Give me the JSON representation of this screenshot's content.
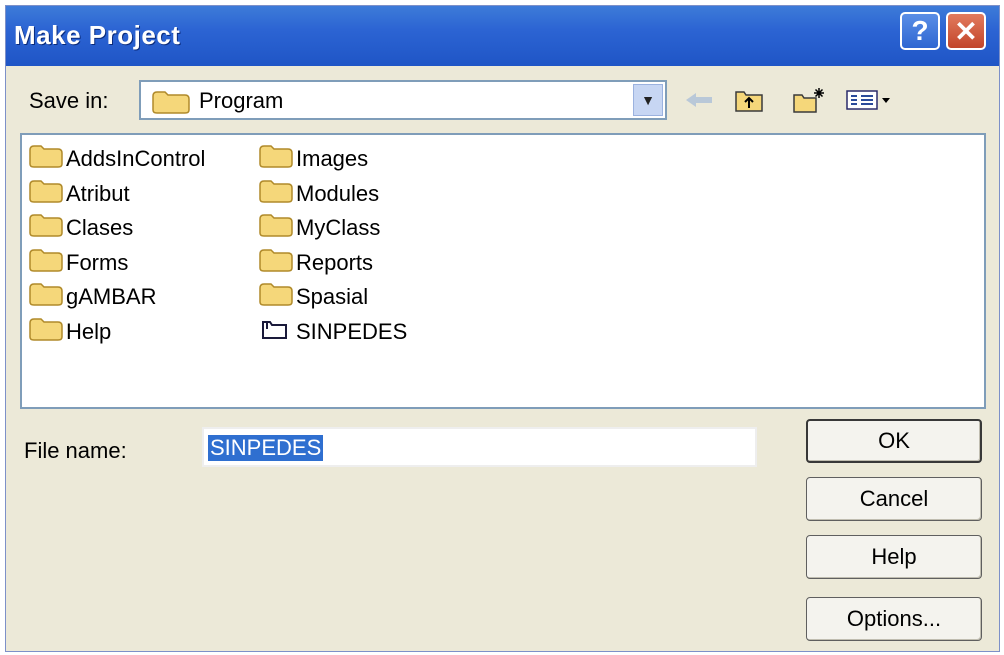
{
  "window": {
    "title": "Make Project",
    "help_symbol": "?",
    "close_symbol": "✕"
  },
  "toolbar": {
    "save_in_label": "Save in:",
    "location": "Program",
    "icons": [
      "folder-icon",
      "back-arrow-icon",
      "up-folder-icon",
      "new-folder-icon",
      "view-menu-icon"
    ]
  },
  "files": {
    "items": [
      {
        "name": "AddsInControl",
        "icon": "folder-icon"
      },
      {
        "name": "Atribut",
        "icon": "folder-icon"
      },
      {
        "name": "Clases",
        "icon": "folder-icon"
      },
      {
        "name": "Forms",
        "icon": "folder-icon"
      },
      {
        "name": "gAMBAR",
        "icon": "folder-icon"
      },
      {
        "name": "Help",
        "icon": "folder-icon"
      },
      {
        "name": "Images",
        "icon": "folder-icon"
      },
      {
        "name": "Modules",
        "icon": "folder-icon"
      },
      {
        "name": "MyClass",
        "icon": "folder-icon"
      },
      {
        "name": "Reports",
        "icon": "folder-icon"
      },
      {
        "name": "Spasial",
        "icon": "folder-icon"
      },
      {
        "name": "SINPEDES",
        "icon": "project-file-icon"
      }
    ]
  },
  "form": {
    "file_name_label": "File name:",
    "file_name_value": "SINPEDES"
  },
  "buttons": {
    "ok": "OK",
    "cancel": "Cancel",
    "help": "Help",
    "options": "Options..."
  },
  "colors": {
    "titlebar": "#2c64d3",
    "dialog_bg": "#ece9d8",
    "selection": "#2f6fd0",
    "close_button": "#c2452a"
  }
}
